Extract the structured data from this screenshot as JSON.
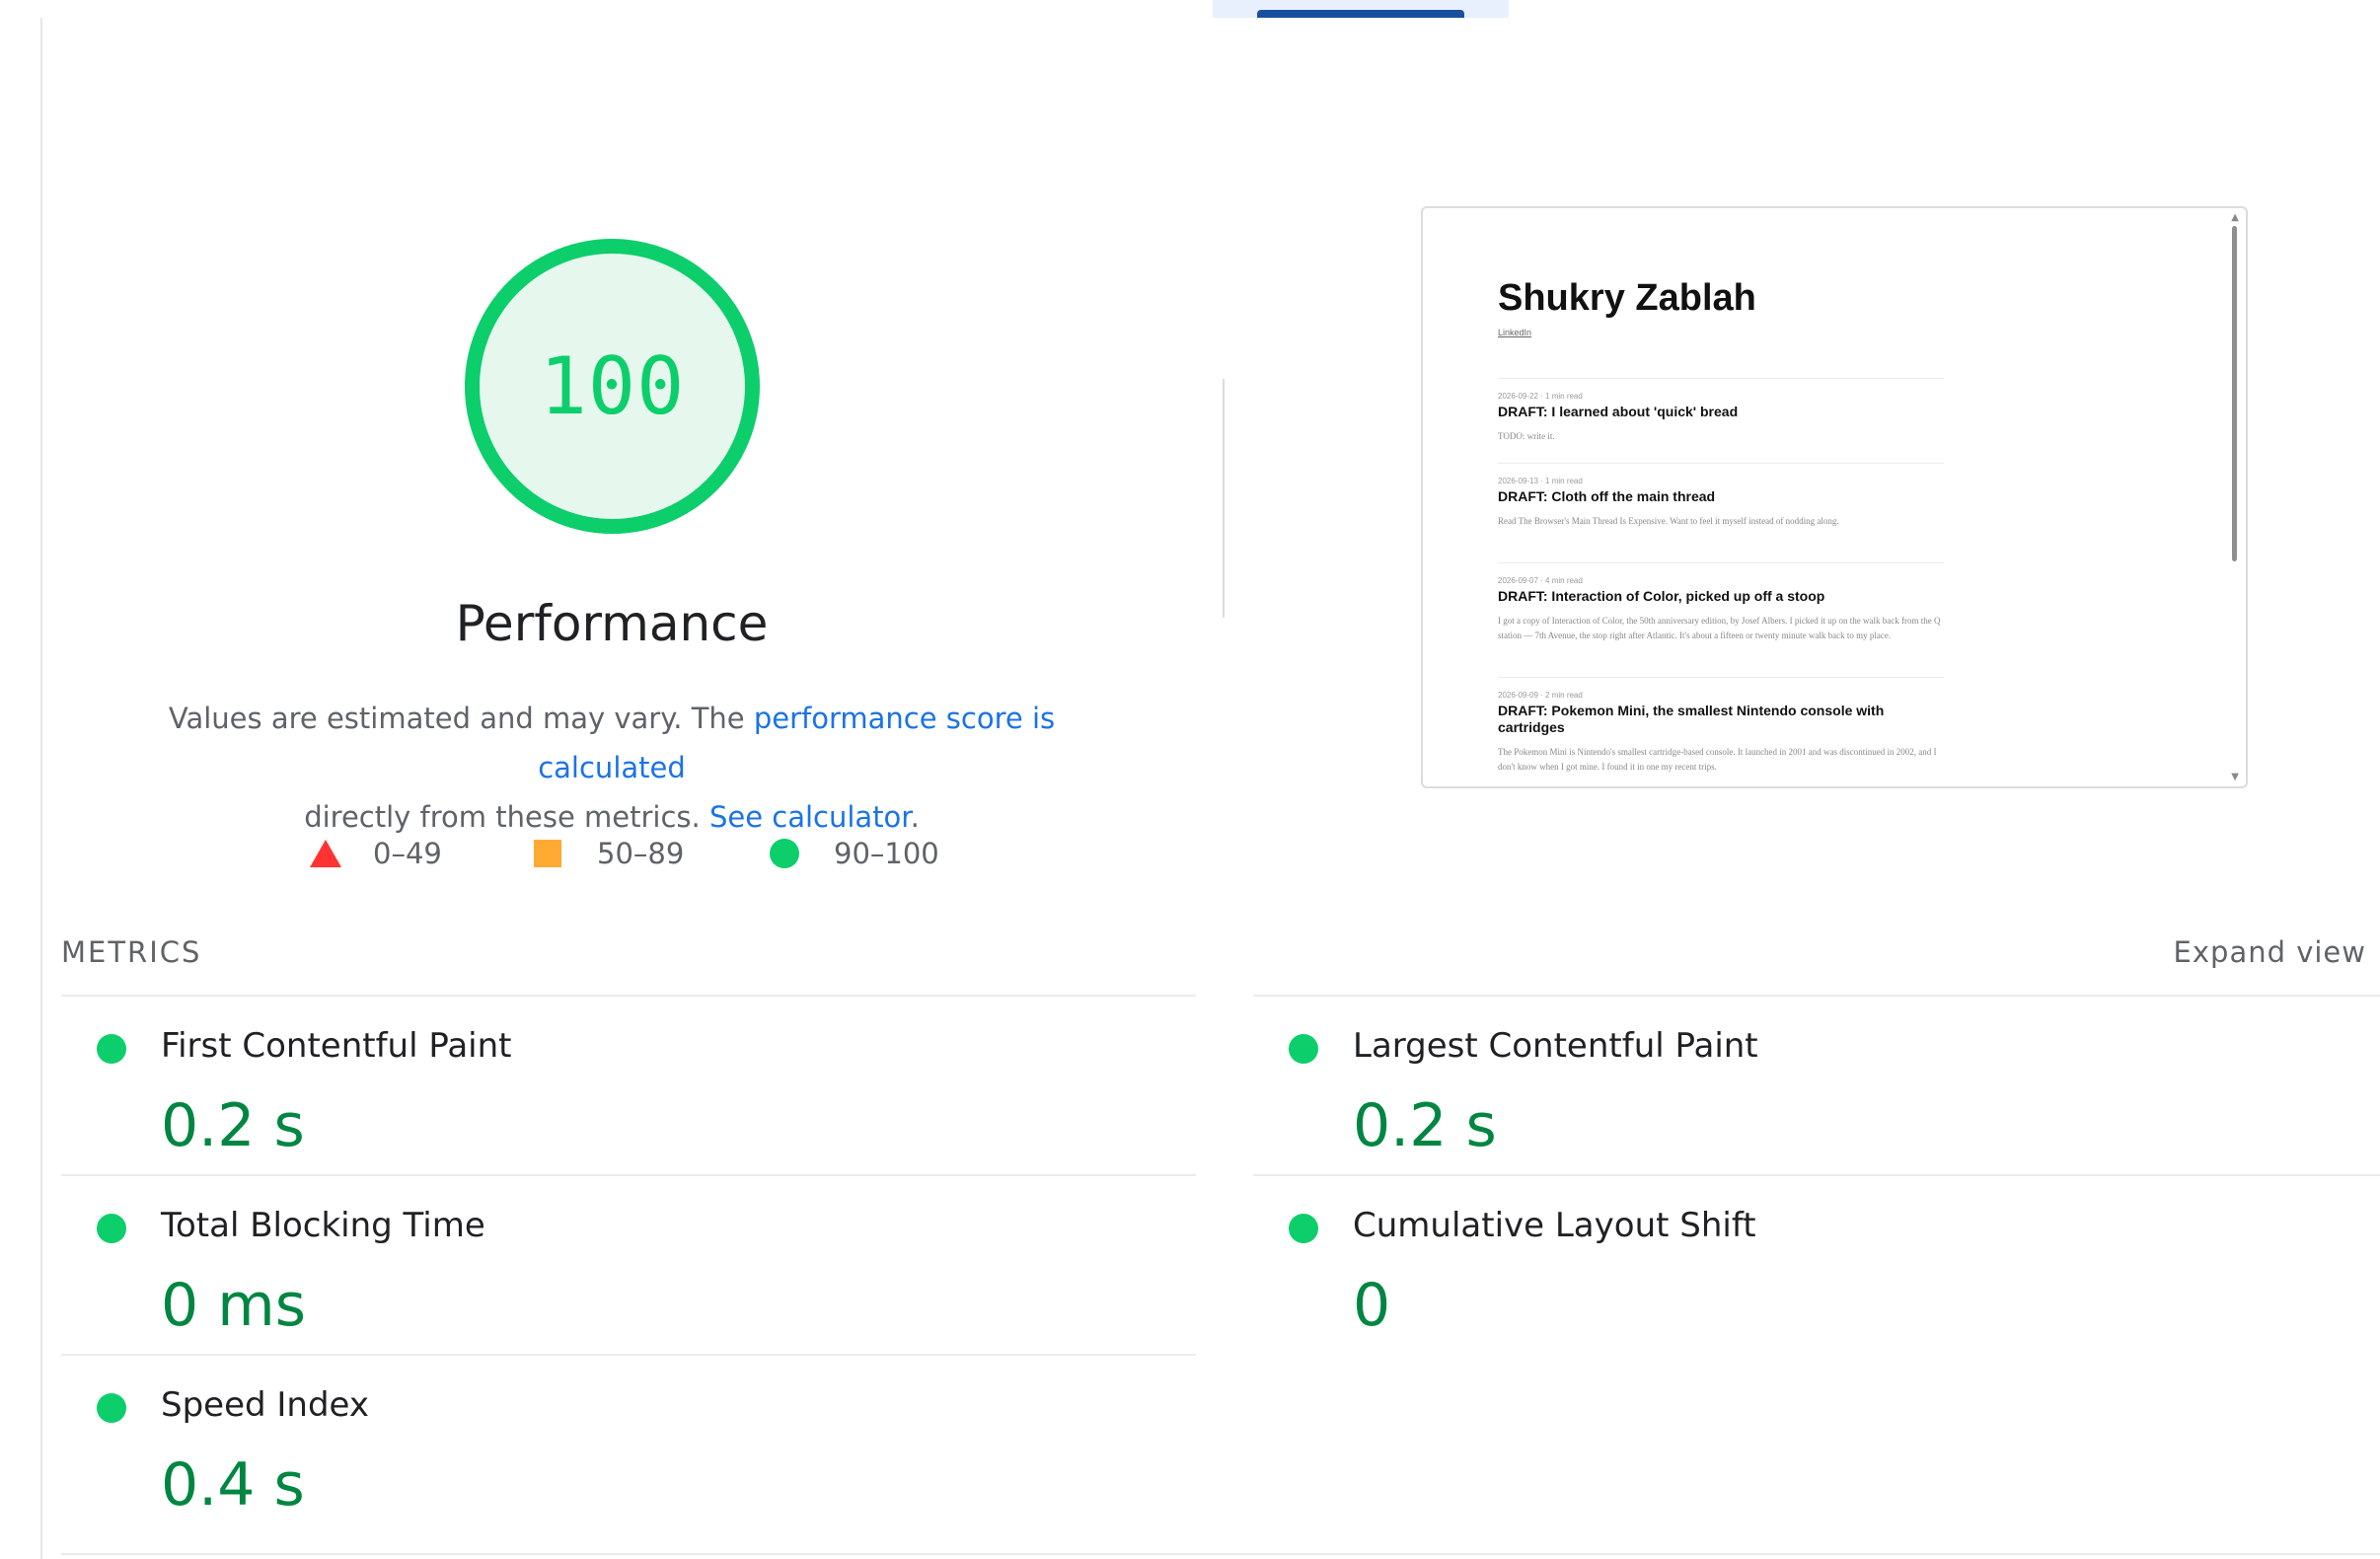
{
  "gauge": {
    "score": "100",
    "title": "Performance",
    "color": "#0cce6b"
  },
  "description": {
    "prefix": "Values are estimated and may vary. The ",
    "link1": "performance score is calculated",
    "mid": "directly from these metrics. ",
    "link2": "See calculator",
    "suffix": "."
  },
  "legend": [
    {
      "icon": "triangle-icon",
      "label": "0–49",
      "color": "#ff3333"
    },
    {
      "icon": "square-icon",
      "label": "50–89",
      "color": "#ffaa33"
    },
    {
      "icon": "circle-icon",
      "label": "90–100",
      "color": "#0cce6b"
    }
  ],
  "preview": {
    "name": "Shukry Zablah",
    "link": "LinkedIn",
    "posts": [
      {
        "meta": "2026-09-22 · 1 min read",
        "title": "DRAFT: I learned about 'quick' bread",
        "excerpt": "TODO: write it."
      },
      {
        "meta": "2026-09-13 · 1 min read",
        "title": "DRAFT: Cloth off the main thread",
        "excerpt": "Read The Browser's Main Thread Is Expensive. Want to feel it myself instead of nodding along."
      },
      {
        "meta": "2026-09-07 · 4 min read",
        "title": "DRAFT: Interaction of Color, picked up off a stoop",
        "excerpt": "I got a copy of Interaction of Color, the 50th anniversary edition, by Josef Albers. I picked it up on the walk back from the Q station — 7th Avenue, the stop right after Atlantic. It's about a fifteen or twenty minute walk back to my place."
      },
      {
        "meta": "2026-09-09 · 2 min read",
        "title": "DRAFT: Pokemon Mini, the smallest Nintendo console with cartridges",
        "excerpt": "The Pokemon Mini is Nintendo's smallest cartridge-based console. It launched in 2001 and was discontinued in 2002, and I don't know when I got mine. I found it in one my recent trips."
      }
    ]
  },
  "metrics": {
    "heading": "METRICS",
    "expand_label": "Expand view",
    "items": [
      {
        "name": "First Contentful Paint",
        "value": "0.2 s"
      },
      {
        "name": "Largest Contentful Paint",
        "value": "0.2 s"
      },
      {
        "name": "Total Blocking Time",
        "value": "0 ms"
      },
      {
        "name": "Cumulative Layout Shift",
        "value": "0"
      },
      {
        "name": "Speed Index",
        "value": "0.4 s"
      }
    ]
  }
}
